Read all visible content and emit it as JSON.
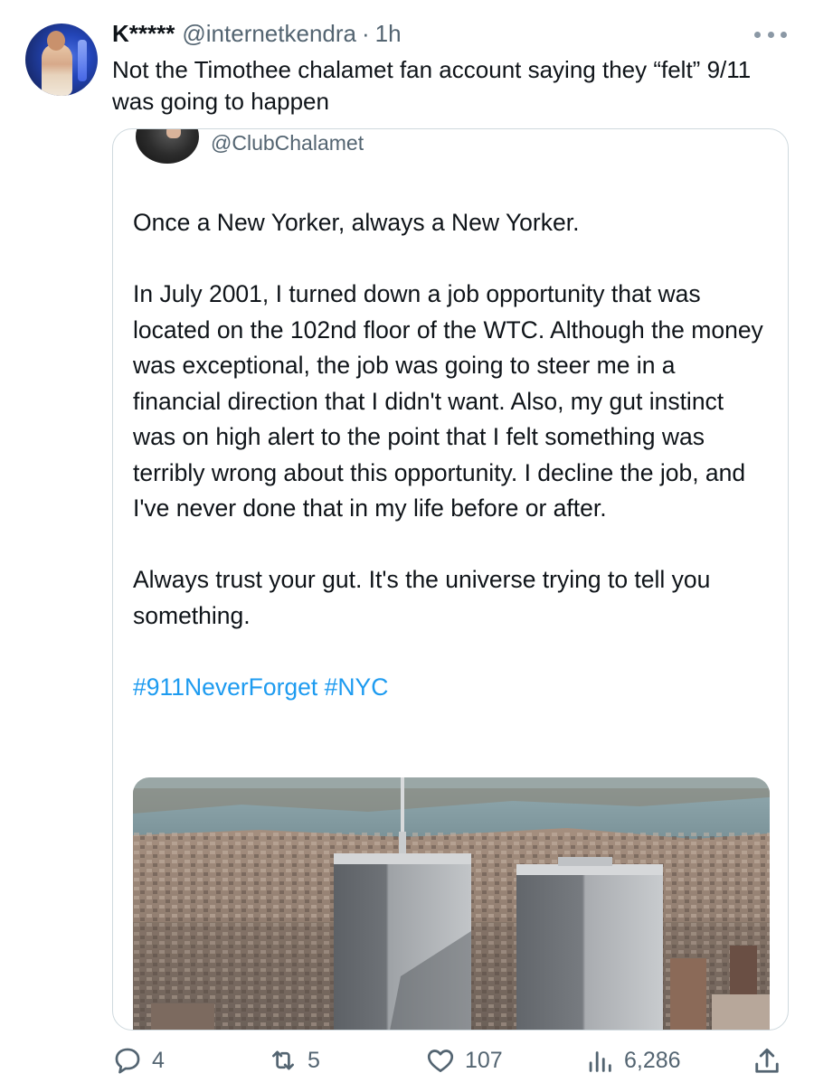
{
  "author": {
    "display_name": "K*****",
    "handle": "@internetkendra",
    "separator": "·",
    "time": "1h"
  },
  "tweet": {
    "text": "Not the Timothee chalamet fan account saying they “felt” 9/11 was going to happen"
  },
  "quoted_tweet": {
    "handle": "@ClubChalamet",
    "paragraphs": [
      "Once a New Yorker, always a New Yorker.",
      "In July 2001, I turned down a job opportunity that was located on the 102nd floor of the WTC. Although the money was exceptional, the job was going to steer me in a financial direction that I didn't want. Also, my gut instinct was on high alert to the point that I felt something was terribly wrong about this opportunity. I decline the job, and I've never done that in my life before or after.",
      "Always trust your gut. It's the universe trying to tell you something."
    ],
    "hashtags": [
      "#911NeverForget",
      "#NYC"
    ]
  },
  "actions": {
    "replies": "4",
    "retweets": "5",
    "likes": "107",
    "views": "6,286"
  },
  "colors": {
    "text": "#0f1419",
    "secondary": "#536471",
    "link": "#1d9bf0",
    "border": "#cfd9de"
  },
  "icons": [
    "more-icon",
    "reply-icon",
    "retweet-icon",
    "like-icon",
    "views-icon",
    "share-icon"
  ]
}
